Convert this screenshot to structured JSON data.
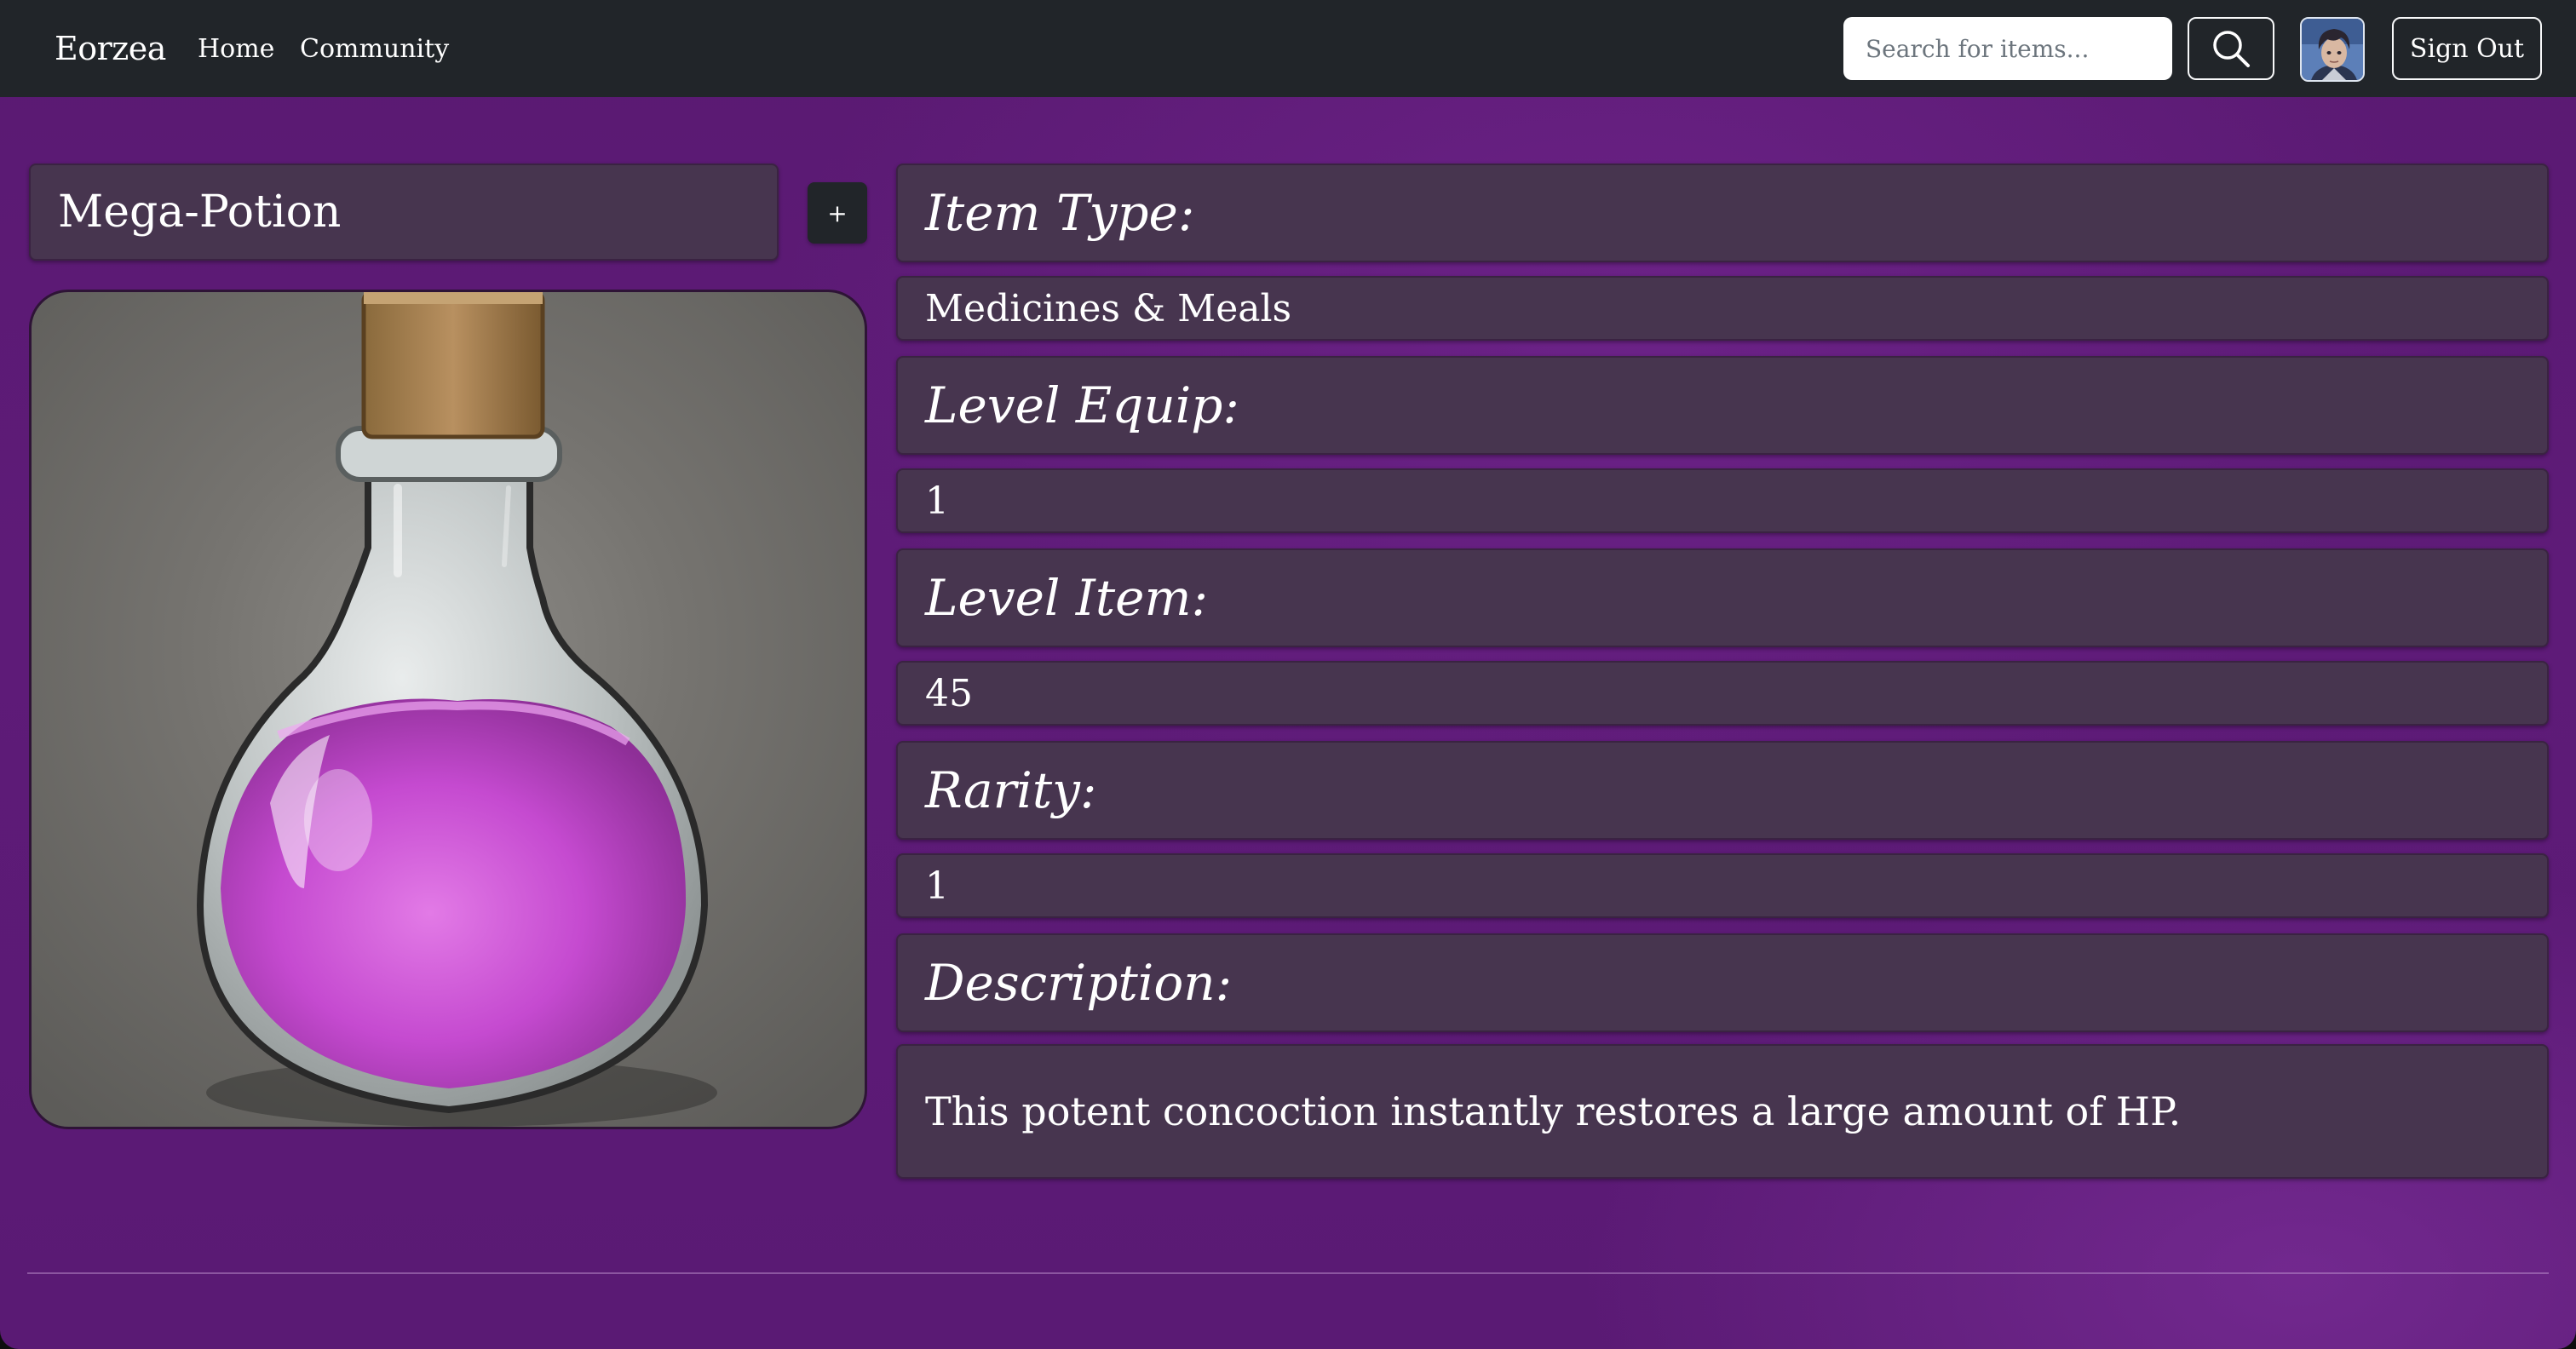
{
  "navbar": {
    "brand": "Eorzea",
    "links": [
      {
        "label": "Home"
      },
      {
        "label": "Community"
      }
    ],
    "search": {
      "placeholder": "Search for items...",
      "value": ""
    },
    "search_button_icon": "search-icon",
    "avatar_icon": "user-avatar",
    "signout_label": "Sign Out"
  },
  "item": {
    "name": "Mega-Potion",
    "add_label": "+",
    "image_icon": "mega-potion-flask",
    "fields": [
      {
        "label": "Item Type:",
        "value": "Medicines & Meals"
      },
      {
        "label": "Level Equip:",
        "value": "1"
      },
      {
        "label": "Level Item:",
        "value": "45"
      },
      {
        "label": "Rarity:",
        "value": "1"
      },
      {
        "label": "Description:",
        "value": "This potent concoction instantly restores a large amount of HP."
      }
    ]
  },
  "colors": {
    "navbar": "#212529",
    "panel": "#47354f",
    "background": "#5e1b78",
    "potion": "#c54ad0"
  }
}
